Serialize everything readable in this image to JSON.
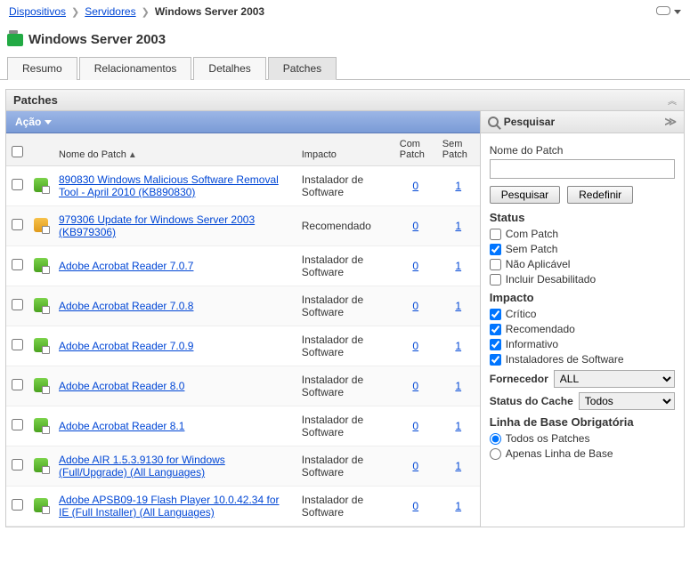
{
  "breadcrumb": {
    "items": [
      "Dispositivos",
      "Servidores"
    ],
    "current": "Windows Server 2003"
  },
  "page_title": "Windows Server 2003",
  "tabs": [
    "Resumo",
    "Relacionamentos",
    "Detalhes",
    "Patches"
  ],
  "active_tab": "Patches",
  "section_title": "Patches",
  "action_menu_label": "Ação",
  "columns": {
    "name": "Nome do Patch",
    "impact": "Impacto",
    "with": "Com Patch",
    "without": "Sem Patch"
  },
  "rows": [
    {
      "icon": "green",
      "name": "890830 Windows Malicious Software Removal Tool - April 2010 (KB890830)",
      "impact": "Instalador de Software",
      "with": "0",
      "without": "1"
    },
    {
      "icon": "orange",
      "name": "979306 Update for Windows Server 2003 (KB979306)",
      "impact": "Recomendado",
      "with": "0",
      "without": "1"
    },
    {
      "icon": "green",
      "name": "Adobe Acrobat Reader 7.0.7",
      "impact": "Instalador de Software",
      "with": "0",
      "without": "1"
    },
    {
      "icon": "green",
      "name": "Adobe Acrobat Reader 7.0.8",
      "impact": "Instalador de Software",
      "with": "0",
      "without": "1"
    },
    {
      "icon": "green",
      "name": "Adobe Acrobat Reader 7.0.9",
      "impact": "Instalador de Software",
      "with": "0",
      "without": "1"
    },
    {
      "icon": "green",
      "name": "Adobe Acrobat Reader 8.0",
      "impact": "Instalador de Software",
      "with": "0",
      "without": "1"
    },
    {
      "icon": "green",
      "name": "Adobe Acrobat Reader 8.1",
      "impact": "Instalador de Software",
      "with": "0",
      "without": "1"
    },
    {
      "icon": "green",
      "name": "Adobe AIR 1.5.3.9130 for Windows (Full/Upgrade) (All Languages)",
      "impact": "Instalador de Software",
      "with": "0",
      "without": "1"
    },
    {
      "icon": "green",
      "name": "Adobe APSB09-19 Flash Player 10.0.42.34 for IE (Full Installer) (All Languages)",
      "impact": "Instalador de Software",
      "with": "0",
      "without": "1"
    }
  ],
  "search": {
    "title": "Pesquisar",
    "name_label": "Nome do Patch",
    "name_value": "",
    "search_btn": "Pesquisar",
    "reset_btn": "Redefinir",
    "status_label": "Status",
    "status": [
      {
        "label": "Com Patch",
        "checked": false
      },
      {
        "label": "Sem Patch",
        "checked": true
      },
      {
        "label": "Não Aplicável",
        "checked": false
      },
      {
        "label": "Incluir Desabilitado",
        "checked": false
      }
    ],
    "impact_label": "Impacto",
    "impact": [
      {
        "label": "Crítico",
        "checked": true
      },
      {
        "label": "Recomendado",
        "checked": true
      },
      {
        "label": "Informativo",
        "checked": true
      },
      {
        "label": "Instaladores de Software",
        "checked": true
      }
    ],
    "vendor_label": "Fornecedor",
    "vendor_value": "ALL",
    "cache_label": "Status do Cache",
    "cache_value": "Todos",
    "baseline_label": "Linha de Base Obrigatória",
    "baseline": [
      {
        "label": "Todos os Patches",
        "checked": true
      },
      {
        "label": "Apenas Linha de Base",
        "checked": false
      }
    ]
  }
}
